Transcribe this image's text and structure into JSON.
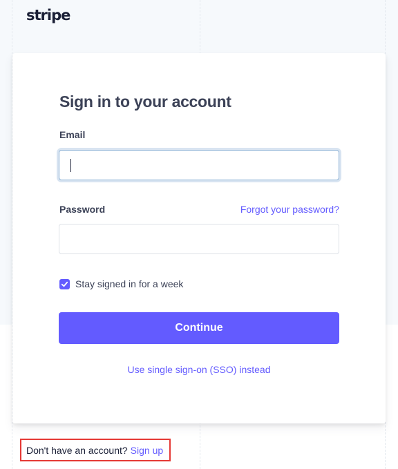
{
  "brand": {
    "logo_text": "stripe"
  },
  "form": {
    "title": "Sign in to your account",
    "email_label": "Email",
    "email_value": "",
    "password_label": "Password",
    "password_value": "",
    "forgot_link": "Forgot your password?",
    "stay_signed_in_label": "Stay signed in for a week",
    "stay_signed_in_checked": true,
    "continue_button": "Continue",
    "sso_link": "Use single sign-on (SSO) instead"
  },
  "footer": {
    "prompt_text": "Don't have an account?",
    "signup_link": "Sign up"
  },
  "colors": {
    "accent": "#635bff",
    "highlight_box": "#e53935"
  },
  "icons": {
    "checkbox": "checkmark-icon"
  }
}
